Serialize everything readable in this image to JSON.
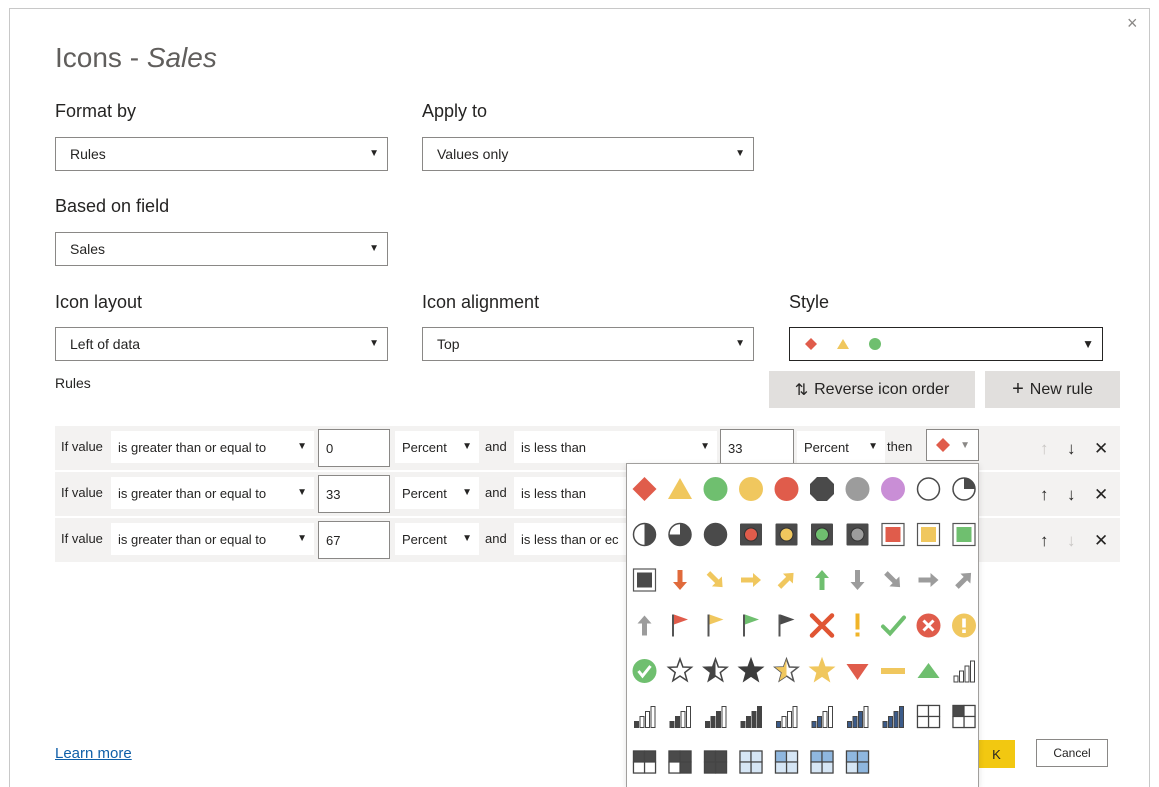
{
  "dialog": {
    "title_prefix": "Icons - ",
    "title_field": "Sales",
    "close_glyph": "×"
  },
  "format_by": {
    "label": "Format by",
    "value": "Rules"
  },
  "apply_to": {
    "label": "Apply to",
    "value": "Values only"
  },
  "based_on_field": {
    "label": "Based on field",
    "value": "Sales"
  },
  "icon_layout": {
    "label": "Icon layout",
    "value": "Left of data"
  },
  "icon_alignment": {
    "label": "Icon alignment",
    "value": "Top"
  },
  "style": {
    "label": "Style",
    "icons": [
      "red-diamond-icon",
      "yellow-triangle-icon",
      "green-circle-icon"
    ]
  },
  "rules_label": "Rules",
  "buttons": {
    "reverse": "Reverse icon order",
    "reverse_glyph": "⇅",
    "new_rule": "New rule",
    "new_rule_glyph": "+",
    "ok": "K",
    "cancel": "Cancel"
  },
  "rules": [
    {
      "if": "If value",
      "op1": "is greater than or equal to",
      "v1": "0",
      "u1": "Percent",
      "and": "and",
      "op2": "is less than",
      "v2": "33",
      "u2": "Percent",
      "then": "then",
      "icon": "red-diamond-icon"
    },
    {
      "if": "If value",
      "op1": "is greater than or equal to",
      "v1": "33",
      "u1": "Percent",
      "and": "and",
      "op2": "is less than"
    },
    {
      "if": "If value",
      "op1": "is greater than or equal to",
      "v1": "67",
      "u1": "Percent",
      "and": "and",
      "op2": "is less than or ec"
    }
  ],
  "learn_more": "Learn more",
  "colors": {
    "accent_yellow": "#f2c811",
    "red": "#e05c4b",
    "yellow": "#f0c75e",
    "green": "#6fbf6f",
    "dark": "#4a4a4a",
    "gray": "#9c9c9c",
    "purple": "#c98ed6",
    "link": "#0f5fa8"
  },
  "icon_picker": {
    "rows": [
      [
        "red-diamond-icon",
        "yellow-triangle-icon",
        "green-circle-icon",
        "yellow-circle-icon",
        "red-circle-icon",
        "black-octagon-icon",
        "gray-circle-icon",
        "purple-circle-icon",
        "empty-circle-icon",
        "quarter-circle-icon"
      ],
      [
        "half-circle-icon",
        "three-quarter-circle-icon",
        "full-dark-circle-icon",
        "red-square-circle-icon",
        "yellow-square-circle-icon",
        "green-square-circle-icon",
        "dark-square-circle-icon",
        "red-outline-square-icon",
        "yellow-outline-square-icon",
        "green-outline-square-icon"
      ],
      [
        "dark-outline-square-icon",
        "red-arrow-down-icon",
        "yellow-arrow-down-right-icon",
        "yellow-arrow-right-icon",
        "yellow-arrow-up-right-icon",
        "green-arrow-up-icon",
        "gray-arrow-down-icon",
        "gray-arrow-down-right-icon",
        "gray-arrow-right-icon",
        "gray-arrow-up-right-icon"
      ],
      [
        "gray-arrow-up-icon",
        "red-flag-icon",
        "yellow-flag-icon",
        "green-flag-icon",
        "black-flag-icon",
        "red-x-icon",
        "yellow-exclamation-icon",
        "green-check-icon",
        "red-x-circle-icon",
        "yellow-exclamation-circle-icon"
      ],
      [
        "green-check-circle-icon",
        "empty-star-icon",
        "half-star-icon",
        "full-star-icon",
        "yellow-half-star-icon",
        "yellow-star-icon",
        "red-triangle-down-icon",
        "yellow-dash-icon",
        "green-triangle-up-icon",
        "signal-0-icon"
      ],
      [
        "signal-1-icon",
        "signal-2-icon",
        "signal-3-icon",
        "signal-4-icon",
        "signal-blue-1-icon",
        "signal-blue-2-icon",
        "signal-blue-3-icon",
        "signal-blue-4-icon",
        "quad-empty-icon",
        "quad-1-icon"
      ],
      [
        "quad-2-icon",
        "quad-3-icon",
        "quad-4-icon",
        "quad-blue-0-icon",
        "quad-blue-1-icon",
        "quad-blue-2-icon",
        "quad-blue-3-icon"
      ]
    ]
  }
}
